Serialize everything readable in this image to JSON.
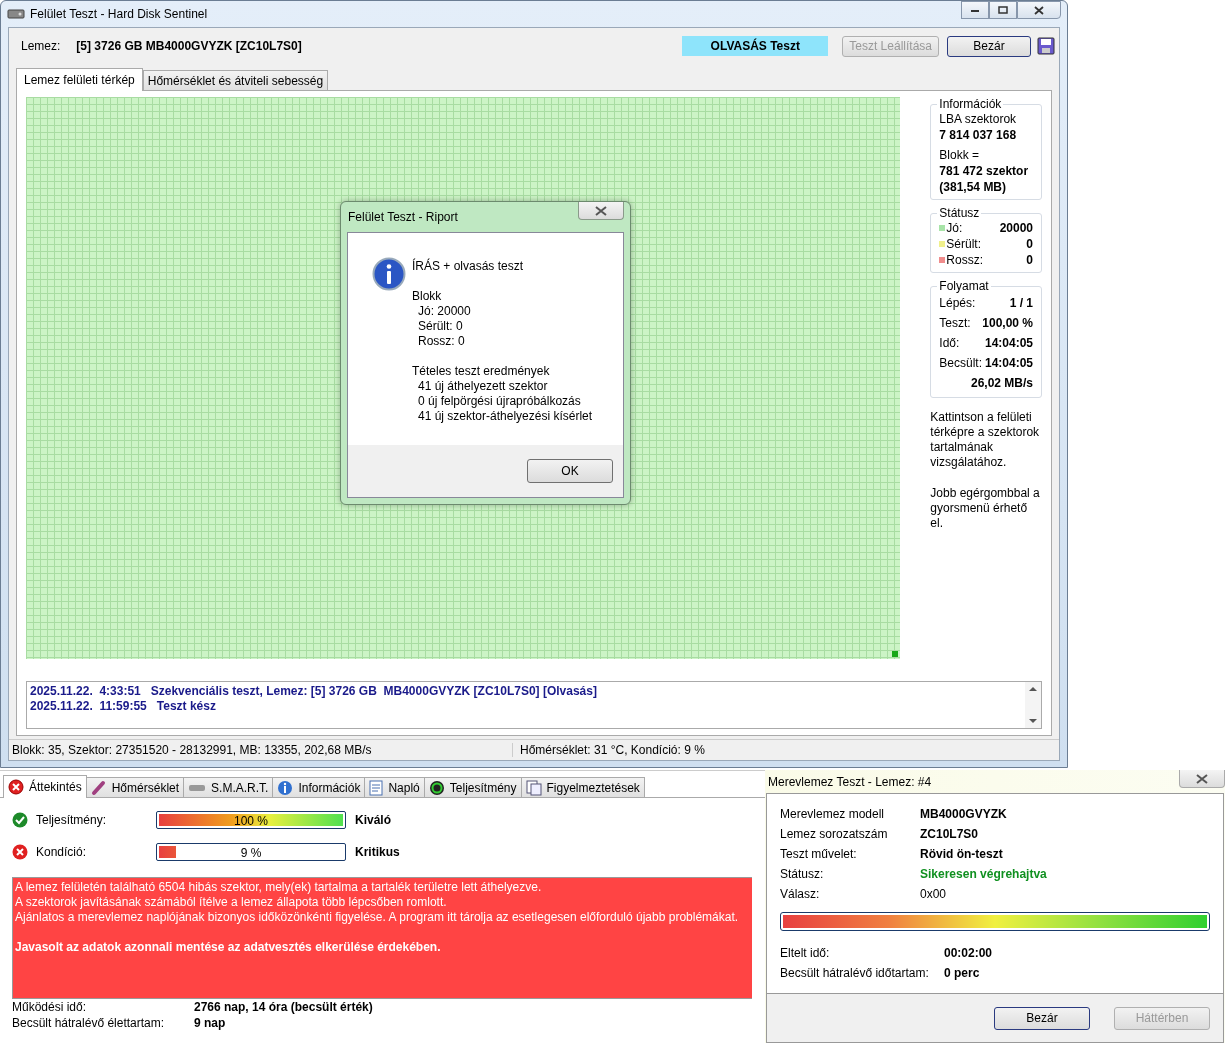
{
  "main_window": {
    "title": "Felület Teszt - Hard Disk Sentinel",
    "disk_label": "Lemez:",
    "disk_value": "[5] 3726 GB  MB4000GVYZK [ZC10L7S0]",
    "mode_badge": "OLVASÁS Teszt",
    "buttons": [
      {
        "label": "Teszt Leállítása",
        "disabled": true
      },
      {
        "label": "Bezár",
        "disabled": false
      }
    ],
    "tabs": [
      {
        "label": "Lemez felületi térkép",
        "selected": true
      },
      {
        "label": "Hőmérséklet és átviteli sebesség",
        "selected": false
      }
    ],
    "info": {
      "title": "Információk",
      "lba_label": "LBA szektorok",
      "lba_value": "7 814 037 168",
      "block_label": "Blokk =",
      "block_value": "781 472 szektor",
      "block_size": "(381,54 MB)"
    },
    "status": {
      "title": "Státusz",
      "items": [
        {
          "label": "Jó:",
          "value": "20000",
          "color": "#a8e4a8"
        },
        {
          "label": "Sérült:",
          "value": "0",
          "color": "#f0f08c"
        },
        {
          "label": "Rossz:",
          "value": "0",
          "color": "#f08c8c"
        }
      ]
    },
    "progress": {
      "title": "Folyamat",
      "rows": [
        {
          "label": "Lépés:",
          "value": "1 / 1"
        },
        {
          "label": "Teszt:",
          "value": "100,00 %"
        },
        {
          "label": "Idő:",
          "value": "14:04:05"
        },
        {
          "label": "Becsült:",
          "value": "14:04:05"
        }
      ],
      "speed": "26,02 MB/s"
    },
    "hints": [
      "Kattintson a felületi térképre a szektorok tartalmának vizsgálatához.",
      "Jobb egérgombbal a gyorsmenü érhető el."
    ],
    "log": [
      {
        "time": "2025.11.22.  4:33:51",
        "message": "Szekvenciális teszt, Lemez: [5] 3726 GB  MB4000GVYZK [ZC10L7S0] [Olvasás]"
      },
      {
        "time": "2025.11.22.  11:59:55",
        "message": "Teszt kész"
      }
    ],
    "status_bar": [
      "Blokk: 35, Szektor: 27351520 - 28132991, MB: 13355, 202,68 MB/s",
      "Hőmérséklet: 31  °C,  Kondíció: 9 %"
    ]
  },
  "report_dialog": {
    "title": "Felület Teszt - Riport",
    "heading": "ÍRÁS + olvasás teszt",
    "sections": [
      {
        "title": "Blokk",
        "children": [
          "Jó: 20000",
          "Sérült: 0",
          "Rossz: 0"
        ]
      },
      {
        "title": "Tételes teszt eredmények",
        "children": [
          "41 új áthelyezett szektor",
          "0 új felpörgési újrapróbálkozás",
          "41 új szektor-áthelyezési kísérlet"
        ]
      }
    ],
    "button": "OK"
  },
  "overview": {
    "tabs": [
      {
        "label": "Áttekintés",
        "selected": true
      },
      {
        "label": "Hőmérséklet",
        "selected": false
      },
      {
        "label": "S.M.A.R.T.",
        "selected": false
      },
      {
        "label": "Információk",
        "selected": false
      },
      {
        "label": "Napló",
        "selected": false
      },
      {
        "label": "Teljesítmény",
        "selected": false
      },
      {
        "label": "Figyelmeztetések",
        "selected": false
      }
    ],
    "meters": [
      {
        "label": "Teljesítmény:",
        "ok": true,
        "level": 1,
        "reading": "100 %",
        "verdict": "Kiváló"
      },
      {
        "label": "Kondíció:",
        "ok": false,
        "level": 0.09,
        "reading": "9 %",
        "verdict": "Kritikus"
      }
    ],
    "alert": {
      "lines": [
        "A lemez felületén található 6504 hibás szektor, mely(ek) tartalma a tartalék területre lett áthelyezve.",
        "A szektorok javításának számából ítélve a lemez állapota több lépcsőben romlott.",
        "Ajánlatos a merevlemez naplójának bizonyos időközönkénti figyelése. A program itt tárolja az esetlegesen előforduló újabb problémákat."
      ],
      "recommendation": "Javasolt az adatok azonnali mentése az adatvesztés elkerülése érdekében."
    },
    "details": [
      {
        "label": "Működési idő:",
        "value": "2766 nap, 14 óra (becsült érték)"
      },
      {
        "label": "Becsült hátralévő élettartam:",
        "value": "9 nap"
      }
    ]
  },
  "self_test_dialog": {
    "title": "Merevlemez Teszt - Lemez: #4",
    "rows": [
      {
        "label": "Merevlemez modell",
        "value": "MB4000GVYZK",
        "kind": "bold"
      },
      {
        "label": "Lemez sorozatszám",
        "value": "ZC10L7S0",
        "kind": "bold"
      },
      {
        "label": "Teszt művelet:",
        "value": "Rövid ön-teszt",
        "kind": "bold"
      },
      {
        "label": "Státusz:",
        "value": "Sikeresen végrehajtva",
        "kind": "success"
      },
      {
        "label": "Válasz:",
        "value": "0x00",
        "kind": "plain"
      }
    ],
    "level": 1,
    "times": [
      {
        "label": "Eltelt idő:",
        "value": "00:02:00"
      },
      {
        "label": "Becsült hátralévő időtartam:",
        "value": "0 perc"
      }
    ],
    "buttons": [
      {
        "label": "Bezár",
        "disabled": false
      },
      {
        "label": "Háttérben",
        "disabled": true
      }
    ]
  }
}
